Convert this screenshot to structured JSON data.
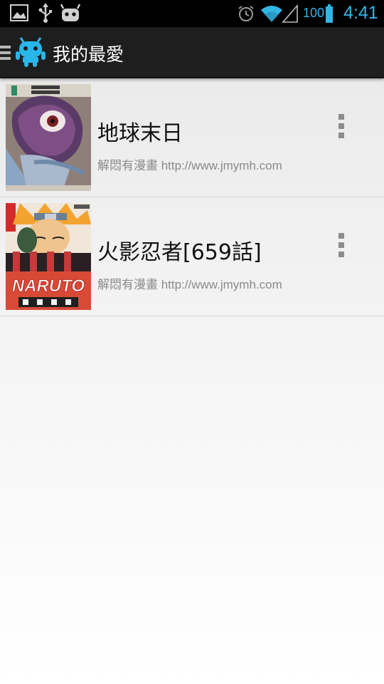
{
  "status_bar": {
    "icons": [
      "gallery-icon",
      "usb-icon",
      "android-debug-icon",
      "alarm-icon",
      "wifi-icon",
      "signal-icon",
      "battery-icon"
    ],
    "battery_level": "100",
    "time": "4:41",
    "accent_color": "#33b5e5"
  },
  "action_bar": {
    "title": "我的最愛",
    "icon": "app-robot-icon",
    "menu_icon": "drawer-indicator-icon"
  },
  "favorites": [
    {
      "title": "地球末日",
      "source": "解悶有漫畫 http://www.jmymh.com",
      "cover_icon": "manga-cover-image"
    },
    {
      "title": "火影忍者[659話]",
      "source": "解悶有漫畫 http://www.jmymh.com",
      "cover_icon": "manga-cover-image",
      "cover_text": "NARUTO"
    }
  ]
}
